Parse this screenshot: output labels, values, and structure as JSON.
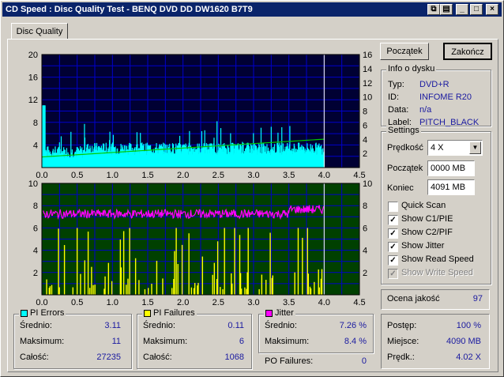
{
  "window": {
    "title": "CD Speed : Disc Quality Test - BENQ    DVD DD DW1620    B7T9"
  },
  "tab": "Disc Quality",
  "buttons": {
    "start": "Początek",
    "end": "Zakończ"
  },
  "disc_info": {
    "caption": "Info o dysku",
    "rows": [
      {
        "label": "Typ:",
        "value": "DVD+R"
      },
      {
        "label": "ID:",
        "value": "INFOME R20"
      },
      {
        "label": "Data:",
        "value": "n/a"
      },
      {
        "label": "Label:",
        "value": "PITCH_BLACK"
      }
    ]
  },
  "settings": {
    "caption": "Settings",
    "speed_label": "Prędkość",
    "speed_value": "4 X",
    "start_label": "Początek",
    "start_value": "0000 MB",
    "end_label": "Koniec",
    "end_value": "4091 MB",
    "checks": [
      {
        "label": "Quick Scan",
        "checked": false,
        "disabled": false
      },
      {
        "label": "Show C1/PIE",
        "checked": true,
        "disabled": false
      },
      {
        "label": "Show C2/PIF",
        "checked": true,
        "disabled": false
      },
      {
        "label": "Show Jitter",
        "checked": true,
        "disabled": false
      },
      {
        "label": "Show Read Speed",
        "checked": true,
        "disabled": false
      },
      {
        "label": "Show Write Speed",
        "checked": true,
        "disabled": true
      }
    ]
  },
  "quality": {
    "label": "Ocena jakość",
    "value": "97"
  },
  "progress": {
    "rows": [
      {
        "label": "Postęp:",
        "value": "100 %"
      },
      {
        "label": "Miejsce:",
        "value": "4090 MB"
      },
      {
        "label": "Prędk.:",
        "value": "4.02 X"
      }
    ]
  },
  "stats": {
    "pi_errors": {
      "caption": "PI Errors",
      "color": "#00ffff",
      "rows": [
        {
          "label": "Średnio:",
          "value": "3.11"
        },
        {
          "label": "Maksimum:",
          "value": "11"
        },
        {
          "label": "Całość:",
          "value": "27235"
        }
      ]
    },
    "pi_failures": {
      "caption": "PI Failures",
      "color": "#ffff00",
      "rows": [
        {
          "label": "Średnio:",
          "value": "0.11"
        },
        {
          "label": "Maksimum:",
          "value": "6"
        },
        {
          "label": "Całość:",
          "value": "1068"
        }
      ]
    },
    "jitter": {
      "caption": "Jitter",
      "color": "#ff00ff",
      "rows": [
        {
          "label": "Średnio:",
          "value": "7.26 %"
        },
        {
          "label": "Maksimum:",
          "value": "8.4 %"
        }
      ]
    },
    "po_failures": {
      "label": "PO Failures:",
      "value": "0"
    }
  },
  "chart_data": [
    {
      "type": "area",
      "name": "top",
      "xlim": [
        0,
        4.5
      ],
      "x_ticks": [
        "0.0",
        "0.5",
        "1.0",
        "1.5",
        "2.0",
        "2.5",
        "3.0",
        "3.5",
        "4.0",
        "4.5"
      ],
      "ylim_left": [
        0,
        20
      ],
      "y_ticks_left": [
        "20",
        "16",
        "12",
        "8",
        "4"
      ],
      "ylim_right": [
        0,
        16
      ],
      "y_ticks_right": [
        "16",
        "14",
        "12",
        "10",
        "8",
        "6",
        "4",
        "2"
      ],
      "colors": {
        "bg": "#000033",
        "pie": "#00ffff",
        "speed": "#00cc00",
        "grid": "#0000cc"
      },
      "pi_errors_avg": 3.11,
      "pi_errors_max": 11,
      "read_speed_start": 1.5,
      "read_speed_end": 4.02,
      "end_x": 4.0
    },
    {
      "type": "bar",
      "name": "bottom",
      "xlim": [
        0,
        4.5
      ],
      "x_ticks": [
        "0.0",
        "0.5",
        "1.0",
        "1.5",
        "2.0",
        "2.5",
        "3.0",
        "3.5",
        "4.0",
        "4.5"
      ],
      "ylim_left": [
        0,
        10
      ],
      "y_ticks_left": [
        "10",
        "8",
        "6",
        "4",
        "2"
      ],
      "ylim_right": [
        0,
        10
      ],
      "y_ticks_right": [
        "10",
        "8",
        "6",
        "4",
        "2"
      ],
      "colors": {
        "bg": "#004000",
        "pif": "#ffff00",
        "jitter": "#ff00ff",
        "grid": "#0000cc"
      },
      "pif_max": 6,
      "jitter_avg": 7.26,
      "jitter_max": 8.4,
      "end_x": 4.0
    }
  ]
}
